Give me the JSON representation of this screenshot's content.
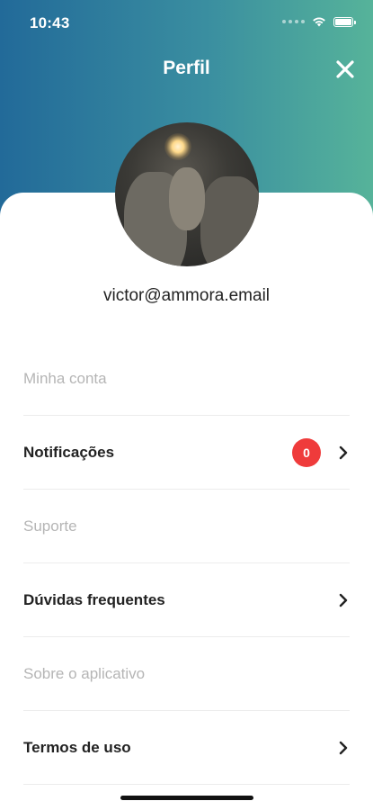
{
  "status_bar": {
    "time": "10:43"
  },
  "header": {
    "title": "Perfil"
  },
  "profile": {
    "email": "victor@ammora.email"
  },
  "menu": {
    "sections": [
      {
        "title": "Minha conta",
        "items": [
          {
            "label": "Notificações",
            "badge": "0"
          }
        ]
      },
      {
        "title": "Suporte",
        "items": [
          {
            "label": "Dúvidas frequentes"
          }
        ]
      },
      {
        "title": "Sobre o aplicativo",
        "items": [
          {
            "label": "Termos de uso"
          }
        ]
      }
    ]
  },
  "colors": {
    "header_gradient_start": "#226a99",
    "header_gradient_end": "#56b39a",
    "badge": "#ef3b3b",
    "section_title": "#b5b5b5"
  }
}
